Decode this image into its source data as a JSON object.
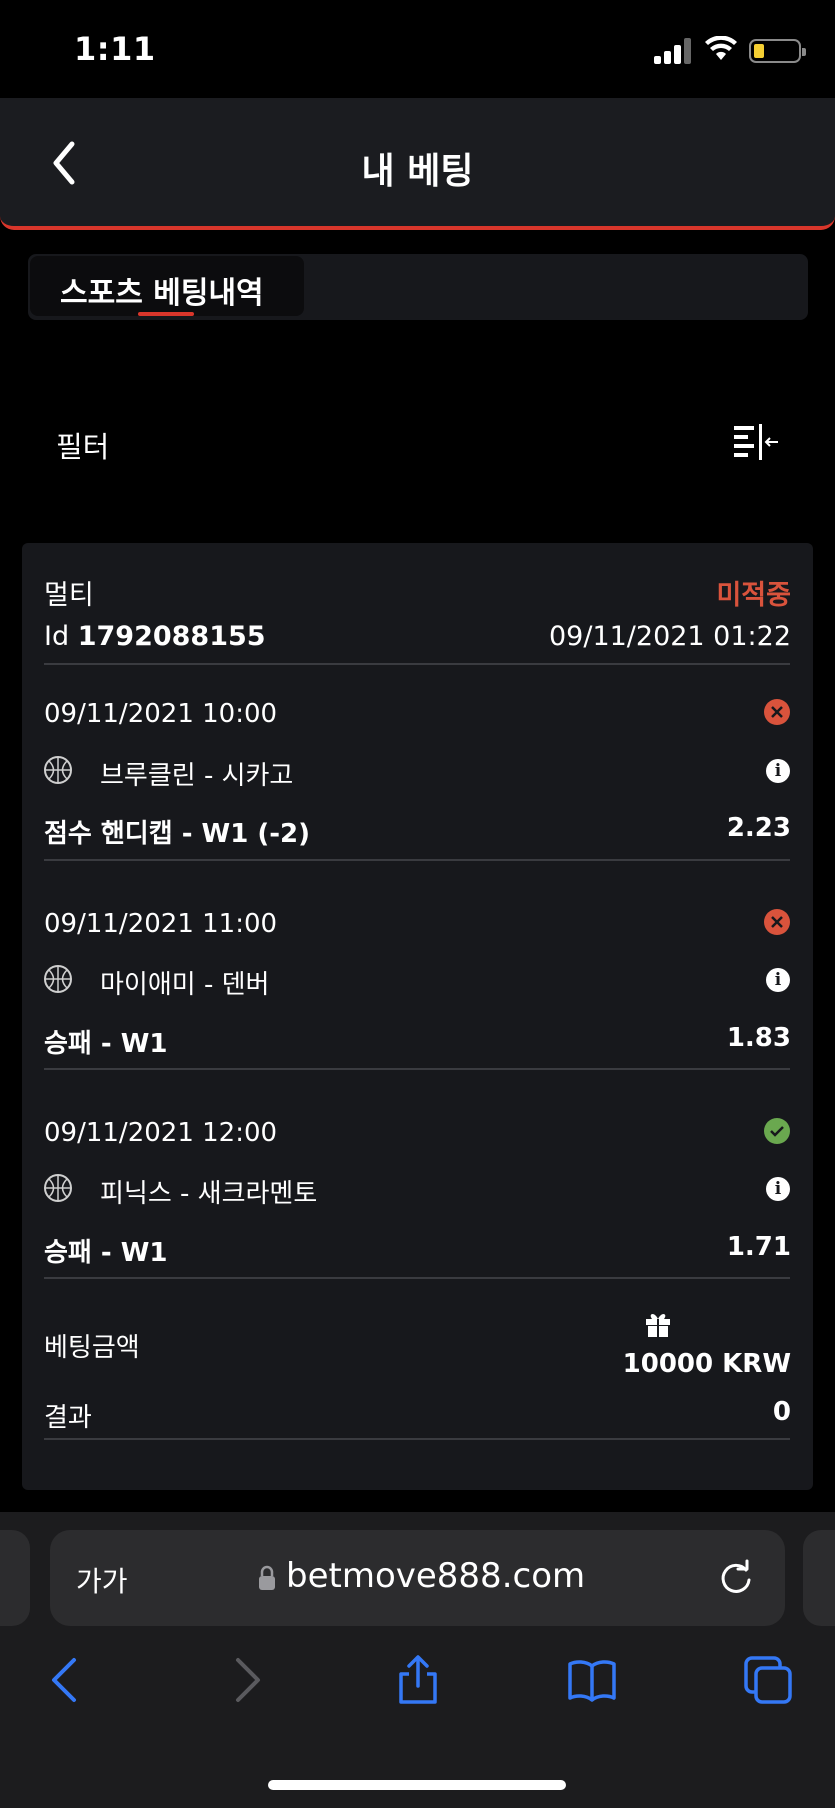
{
  "status_bar": {
    "time": "1:11"
  },
  "header": {
    "title": "내 베팅"
  },
  "tabs": [
    {
      "label": "스포츠 베팅내역",
      "active": true
    }
  ],
  "filter": {
    "label": "필터"
  },
  "bet": {
    "type": "멀티",
    "status": "미적중",
    "id_label": "Id",
    "id": "1792088155",
    "placed_at": "09/11/2021 01:22",
    "selections": [
      {
        "datetime": "09/11/2021 10:00",
        "teams": "브루클린 - 시카고",
        "market": "점수 핸디캡 - W1 (-2)",
        "odds": "2.23",
        "result": "lost",
        "sport": "basketball"
      },
      {
        "datetime": "09/11/2021 11:00",
        "teams": "마이애미 - 덴버",
        "market": "승패 - W1",
        "odds": "1.83",
        "result": "lost",
        "sport": "basketball"
      },
      {
        "datetime": "09/11/2021 12:00",
        "teams": "피닉스 - 새크라멘토",
        "market": "승패 - W1",
        "odds": "1.71",
        "result": "won",
        "sport": "basketball"
      }
    ],
    "stake_label": "베팅금액",
    "stake": "10000 KRW",
    "result_label": "결과",
    "result": "0"
  },
  "browser": {
    "aa_label": "가가",
    "url": "betmove888.com"
  },
  "colors": {
    "accent": "#d9362b",
    "lost": "#d9533c",
    "won": "#6aa84f",
    "ios_blue": "#3478f6"
  }
}
